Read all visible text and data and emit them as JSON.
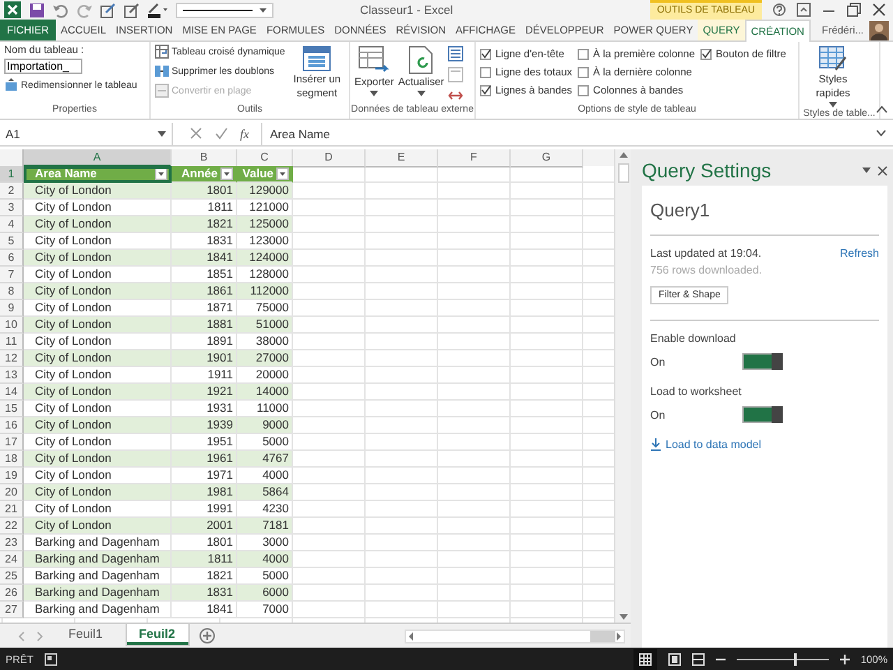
{
  "title_bar": {
    "title": "Classeur1 - Excel",
    "context_label": "OUTILS DE TABLEAU"
  },
  "ribbon_tabs": [
    {
      "label": "FICHIER",
      "kind": "file",
      "selected": false
    },
    {
      "label": "ACCUEIL",
      "kind": "tab",
      "selected": false
    },
    {
      "label": "INSERTION",
      "kind": "tab",
      "selected": false
    },
    {
      "label": "MISE EN PAGE",
      "kind": "tab",
      "selected": false
    },
    {
      "label": "FORMULES",
      "kind": "tab",
      "selected": false
    },
    {
      "label": "DONNÉES",
      "kind": "tab",
      "selected": false
    },
    {
      "label": "RÉVISION",
      "kind": "tab",
      "selected": false
    },
    {
      "label": "AFFICHAGE",
      "kind": "tab",
      "selected": false
    },
    {
      "label": "DÉVELOPPEUR",
      "kind": "tab",
      "selected": false
    },
    {
      "label": "POWER QUERY",
      "kind": "tab",
      "selected": false
    },
    {
      "label": "QUERY",
      "kind": "context",
      "selected": false
    },
    {
      "label": "CRÉATION",
      "kind": "context",
      "selected": true
    }
  ],
  "user": "Frédéri...",
  "ribbon": {
    "properties": {
      "name_label": "Nom du tableau :",
      "table_name": "Importation_",
      "resize": "Redimensionner le tableau",
      "group": "Properties"
    },
    "tools": {
      "items": [
        {
          "label": "Tableau croisé dynamique",
          "disabled": false
        },
        {
          "label": "Supprimer les doublons",
          "disabled": false
        },
        {
          "label": "Convertir en plage",
          "disabled": true
        }
      ],
      "slicer": "Insérer un segment",
      "group": "Outils"
    },
    "external": {
      "export": "Exporter",
      "refresh": "Actualiser",
      "group": "Données de tableau externe"
    },
    "style_options": {
      "options": [
        {
          "label": "Ligne d'en-tête",
          "checked": true
        },
        {
          "label": "Ligne des totaux",
          "checked": false
        },
        {
          "label": "Lignes à bandes",
          "checked": true
        },
        {
          "label": "À la première colonne",
          "checked": false
        },
        {
          "label": "À la dernière colonne",
          "checked": false
        },
        {
          "label": "Colonnes à bandes",
          "checked": false
        },
        {
          "label": "Bouton de filtre",
          "checked": true
        }
      ],
      "group": "Options de style de tableau"
    },
    "styles": {
      "button": "Styles rapides",
      "group": "Styles de table..."
    }
  },
  "formula_bar": {
    "name_box": "A1",
    "function_label": "fx",
    "formula": "Area Name"
  },
  "sheet": {
    "columns": [
      {
        "label": "A",
        "selected": true
      },
      {
        "label": "B",
        "selected": false
      },
      {
        "label": "C",
        "selected": false
      },
      {
        "label": "D",
        "selected": false
      },
      {
        "label": "E",
        "selected": false
      },
      {
        "label": "F",
        "selected": false
      },
      {
        "label": "G",
        "selected": false
      }
    ],
    "header": {
      "num": "1",
      "cells": [
        "Area Name",
        "Année",
        "Value"
      ]
    },
    "rows": [
      {
        "num": "2",
        "cells": [
          "City of London",
          "1801",
          "129000"
        ]
      },
      {
        "num": "3",
        "cells": [
          "City of London",
          "1811",
          "121000"
        ]
      },
      {
        "num": "4",
        "cells": [
          "City of London",
          "1821",
          "125000"
        ]
      },
      {
        "num": "5",
        "cells": [
          "City of London",
          "1831",
          "123000"
        ]
      },
      {
        "num": "6",
        "cells": [
          "City of London",
          "1841",
          "124000"
        ]
      },
      {
        "num": "7",
        "cells": [
          "City of London",
          "1851",
          "128000"
        ]
      },
      {
        "num": "8",
        "cells": [
          "City of London",
          "1861",
          "112000"
        ]
      },
      {
        "num": "9",
        "cells": [
          "City of London",
          "1871",
          "75000"
        ]
      },
      {
        "num": "10",
        "cells": [
          "City of London",
          "1881",
          "51000"
        ]
      },
      {
        "num": "11",
        "cells": [
          "City of London",
          "1891",
          "38000"
        ]
      },
      {
        "num": "12",
        "cells": [
          "City of London",
          "1901",
          "27000"
        ]
      },
      {
        "num": "13",
        "cells": [
          "City of London",
          "1911",
          "20000"
        ]
      },
      {
        "num": "14",
        "cells": [
          "City of London",
          "1921",
          "14000"
        ]
      },
      {
        "num": "15",
        "cells": [
          "City of London",
          "1931",
          "11000"
        ]
      },
      {
        "num": "16",
        "cells": [
          "City of London",
          "1939",
          "9000"
        ]
      },
      {
        "num": "17",
        "cells": [
          "City of London",
          "1951",
          "5000"
        ]
      },
      {
        "num": "18",
        "cells": [
          "City of London",
          "1961",
          "4767"
        ]
      },
      {
        "num": "19",
        "cells": [
          "City of London",
          "1971",
          "4000"
        ]
      },
      {
        "num": "20",
        "cells": [
          "City of London",
          "1981",
          "5864"
        ]
      },
      {
        "num": "21",
        "cells": [
          "City of London",
          "1991",
          "4230"
        ]
      },
      {
        "num": "22",
        "cells": [
          "City of London",
          "2001",
          "7181"
        ]
      },
      {
        "num": "23",
        "cells": [
          "Barking and Dagenham",
          "1801",
          "3000"
        ]
      },
      {
        "num": "24",
        "cells": [
          "Barking and Dagenham",
          "1811",
          "4000"
        ]
      },
      {
        "num": "25",
        "cells": [
          "Barking and Dagenham",
          "1821",
          "5000"
        ]
      },
      {
        "num": "26",
        "cells": [
          "Barking and Dagenham",
          "1831",
          "6000"
        ]
      },
      {
        "num": "27",
        "cells": [
          "Barking and Dagenham",
          "1841",
          "7000"
        ]
      }
    ]
  },
  "sheet_tabs": [
    {
      "label": "Feuil1",
      "selected": false
    },
    {
      "label": "Feuil2",
      "selected": true
    }
  ],
  "query_settings": {
    "title": "Query Settings",
    "query_name": "Query1",
    "last_updated": "Last updated at 19:04.",
    "refresh": "Refresh",
    "rows_downloaded": "756 rows downloaded.",
    "filter_button": "Filter & Shape",
    "toggles": [
      {
        "label": "Enable download",
        "state_label": "On",
        "on": true
      },
      {
        "label": "Load to worksheet",
        "state_label": "On",
        "on": true
      }
    ],
    "data_model_link": "Load to data model"
  },
  "status_bar": {
    "mode": "PRÊT",
    "zoom": {
      "level": 0.64
    },
    "zoom_label": "100%"
  }
}
